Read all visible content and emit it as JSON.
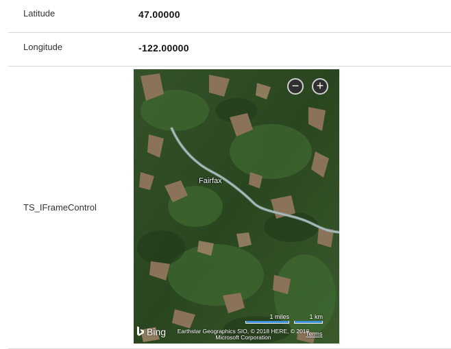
{
  "fields": {
    "latitude": {
      "label": "Latitude",
      "value": "47.00000"
    },
    "longitude": {
      "label": "Longitude",
      "value": "-122.00000"
    },
    "iframe_control": {
      "label": "TS_IFrameControl"
    }
  },
  "map": {
    "place_label": "Fairfax",
    "zoom_out_icon": "minus-icon",
    "zoom_in_icon": "plus-icon",
    "zoom_out_symbol": "−",
    "zoom_in_symbol": "+",
    "brand": "Bing",
    "scale_miles": "1 miles",
    "scale_km": "1 km",
    "copyright": "Earthstar Geographics SIO, © 2018 HERE, © 2018 Microsoft Corporation",
    "terms": "Terms",
    "colors": {
      "forest": "#2c4a22",
      "clearing": "#8a7358",
      "river": "#8fa6a6"
    }
  }
}
